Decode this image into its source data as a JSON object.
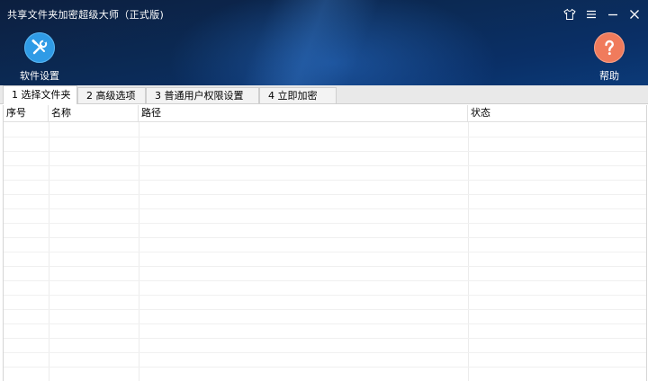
{
  "window": {
    "title": "共享文件夹加密超级大师（正式版)"
  },
  "toolbar": {
    "settings_label": "软件设置",
    "help_label": "帮助"
  },
  "tabs": [
    {
      "label": "1 选择文件夹"
    },
    {
      "label": "2 高级选项"
    },
    {
      "label": "3 普通用户权限设置"
    },
    {
      "label": "4 立即加密"
    }
  ],
  "table": {
    "columns": [
      "序号",
      "名称",
      "路径",
      "状态"
    ],
    "rows": []
  },
  "colors": {
    "header_bg": "#0b2a55",
    "settings_icon_bg": "#2f9be6",
    "help_icon_bg": "#f07b5c"
  },
  "icons": {
    "settings": "wrench-screwdriver-icon",
    "help": "question-mark-icon",
    "skin": "tshirt-icon",
    "menu": "hamburger-menu-icon",
    "minimize": "minimize-icon",
    "close": "close-icon"
  }
}
